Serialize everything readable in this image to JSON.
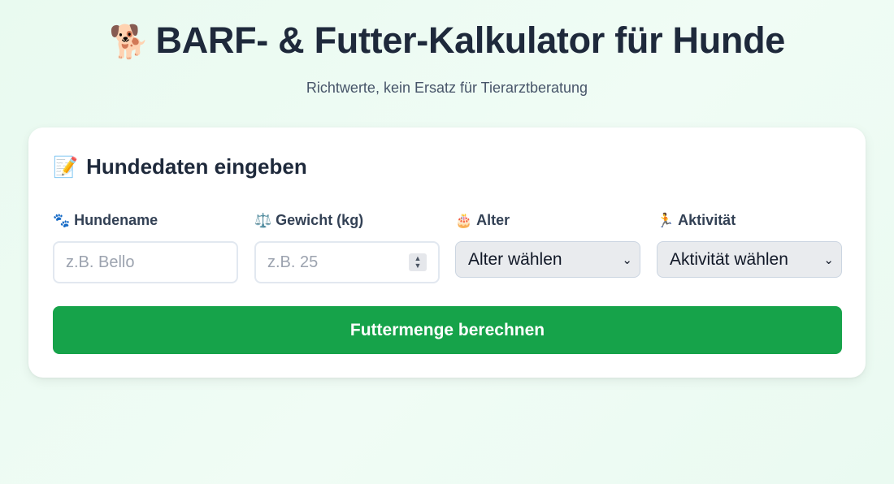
{
  "header": {
    "icon": "🐕",
    "title": "BARF- & Futter-Kalkulator für Hunde",
    "subtitle": "Richtwerte, kein Ersatz für Tierarztberatung"
  },
  "form": {
    "icon": "📝",
    "title": "Hundedaten eingeben",
    "fields": {
      "name": {
        "icon": "🐾",
        "label": "Hundename",
        "placeholder": "z.B. Bello"
      },
      "weight": {
        "icon": "⚖️",
        "label": "Gewicht (kg)",
        "placeholder": "z.B. 25"
      },
      "age": {
        "icon": "🎂",
        "label": "Alter",
        "selected": "Alter wählen"
      },
      "activity": {
        "icon": "🏃",
        "label": "Aktivität",
        "selected": "Aktivität wählen"
      }
    },
    "submit_label": "Futtermenge berechnen"
  },
  "colors": {
    "accent": "#16a34a",
    "background": "#e9faf0",
    "title_text": "#1e293b"
  }
}
